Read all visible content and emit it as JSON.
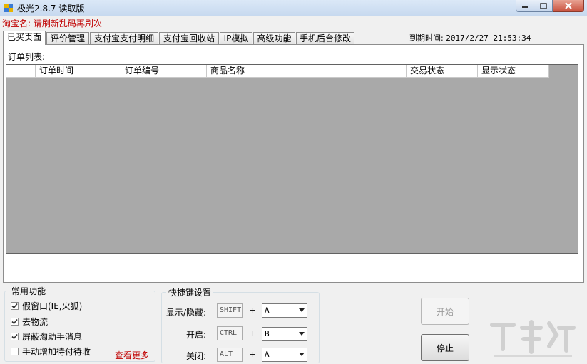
{
  "window": {
    "title": "极光2.8.7 读取版"
  },
  "shop": {
    "label": "淘宝名:",
    "value": "请刷新乱码再刷次"
  },
  "tabs": [
    {
      "label": "已买页面"
    },
    {
      "label": "评价管理"
    },
    {
      "label": "支付宝支付明细"
    },
    {
      "label": "支付宝回收站"
    },
    {
      "label": "IP模拟"
    },
    {
      "label": "高级功能"
    },
    {
      "label": "手机后台修改"
    }
  ],
  "expire": {
    "label": "到期时间:",
    "value": "2017/2/27 21:53:34"
  },
  "orders": {
    "label": "订单列表:",
    "columns": [
      "",
      "订单时间",
      "订单编号",
      "商品名称",
      "交易状态",
      "显示状态"
    ],
    "rows": []
  },
  "common": {
    "title": "常用功能",
    "options": [
      {
        "label": "假窗口(IE,火狐)",
        "checked": true
      },
      {
        "label": "去物流",
        "checked": true
      },
      {
        "label": "屏蔽淘助手消息",
        "checked": true
      },
      {
        "label": "手动增加待付待收",
        "checked": false
      }
    ],
    "more_link": "查看更多"
  },
  "hotkeys": {
    "title": "快捷键设置",
    "rows": [
      {
        "label": "显示/隐藏:",
        "modifier": "SHIFT",
        "plus": "+",
        "key": "A"
      },
      {
        "label": "开启:",
        "modifier": "CTRL",
        "plus": "+",
        "key": "B"
      },
      {
        "label": "关闭:",
        "modifier": "ALT",
        "plus": "+",
        "key": "A"
      }
    ]
  },
  "buttons": {
    "start": "开始",
    "stop": "停止"
  },
  "colors": {
    "accent_red": "#c00000",
    "grid_bg": "#a9a9a9"
  }
}
